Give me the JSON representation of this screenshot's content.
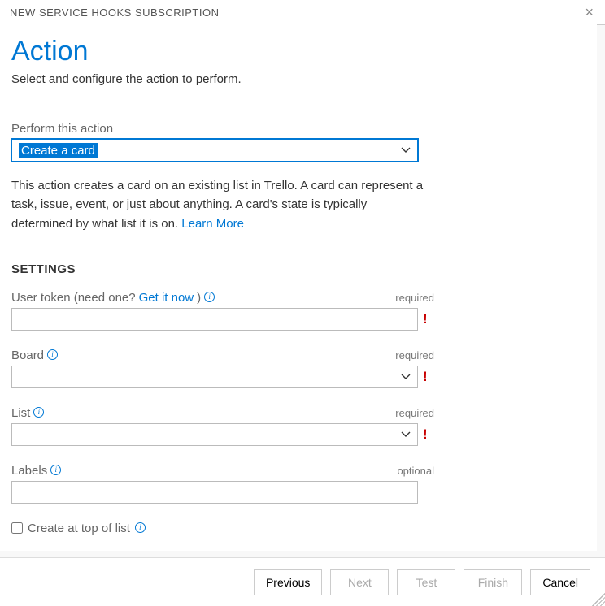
{
  "dialog": {
    "title": "NEW SERVICE HOOKS SUBSCRIPTION"
  },
  "heading": "Action",
  "subtitle": "Select and configure the action to perform.",
  "actionField": {
    "label": "Perform this action",
    "selected": "Create a card"
  },
  "description": {
    "text": "This action creates a card on an existing list in Trello. A card can represent a task, issue, event, or just about anything. A card's state is typically determined by what list it is on. ",
    "learnMore": "Learn More"
  },
  "settingsHeading": "SETTINGS",
  "fields": {
    "userToken": {
      "labelPrefix": "User token (need one? ",
      "labelLink": "Get it now",
      "labelSuffix": ") ",
      "requirement": "required",
      "value": ""
    },
    "board": {
      "label": "Board",
      "requirement": "required",
      "value": ""
    },
    "list": {
      "label": "List",
      "requirement": "required",
      "value": ""
    },
    "labels": {
      "label": "Labels",
      "requirement": "optional",
      "value": ""
    },
    "createTop": {
      "label": "Create at top of list",
      "checked": false
    }
  },
  "buttons": {
    "previous": "Previous",
    "next": "Next",
    "test": "Test",
    "finish": "Finish",
    "cancel": "Cancel"
  }
}
